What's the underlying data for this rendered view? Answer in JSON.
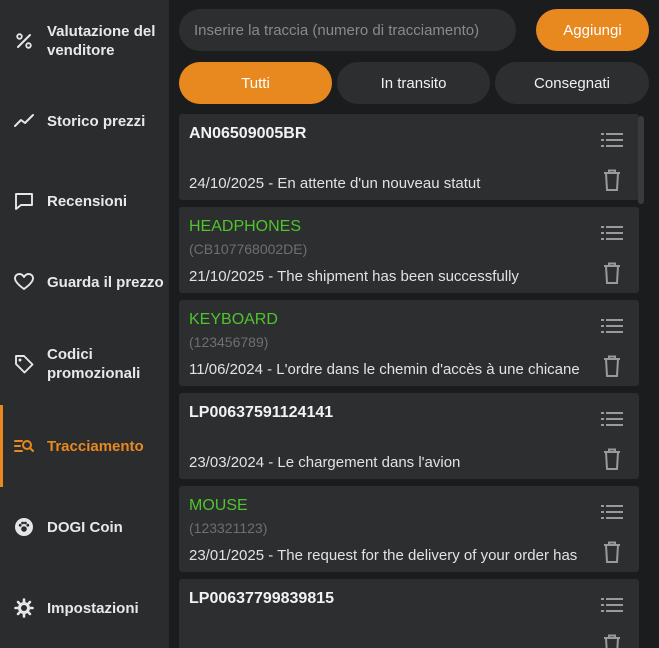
{
  "sidebar": {
    "items": [
      {
        "label": "Valutazione del venditore",
        "icon": "percent-icon",
        "active": false
      },
      {
        "label": "Storico prezzi",
        "icon": "trend-line-icon",
        "active": false
      },
      {
        "label": "Recensioni",
        "icon": "chat-bubble-icon",
        "active": false
      },
      {
        "label": "Guarda il prezzo",
        "icon": "heart-icon",
        "active": false
      },
      {
        "label": "Codici promozionali",
        "icon": "tag-icon",
        "active": false
      },
      {
        "label": "Tracciamento",
        "icon": "tracking-search-icon",
        "active": true
      },
      {
        "label": "DOGI Coin",
        "icon": "paw-coin-icon",
        "active": false
      },
      {
        "label": "Impostazioni",
        "icon": "gear-icon",
        "active": false
      }
    ]
  },
  "search": {
    "placeholder": "Inserire la traccia (numero di tracciamento)",
    "value": "",
    "add_label": "Aggiungi"
  },
  "tabs": [
    {
      "label": "Tutti",
      "active": true
    },
    {
      "label": "In transito",
      "active": false
    },
    {
      "label": "Consegnati",
      "active": false
    }
  ],
  "shipments": [
    {
      "title": "AN06509005BR",
      "code": "",
      "status": "24/10/2025 - En attente d'un nouveau statut"
    },
    {
      "title": "HEADPHONES",
      "code": "(CB107768002DE)",
      "status": "21/10/2025 - The shipment has been successfully"
    },
    {
      "title": "KEYBOARD",
      "code": "(123456789)",
      "status": "11/06/2024 - L'ordre dans le chemin d'accès à une chicane"
    },
    {
      "title": "LP00637591124141",
      "code": "",
      "status": "23/03/2024 - Le chargement dans l'avion"
    },
    {
      "title": "MOUSE",
      "code": "(123321123)",
      "status": "23/01/2025 - The request for the delivery of your order has"
    },
    {
      "title": "LP00637799839815",
      "code": "",
      "status": ""
    }
  ],
  "colors": {
    "accent": "#e8891f",
    "named_title": "#4fc42c",
    "sidebar_bg": "#2b2c2e",
    "main_bg": "#1b1c1e",
    "card_bg": "#2d2e30"
  }
}
